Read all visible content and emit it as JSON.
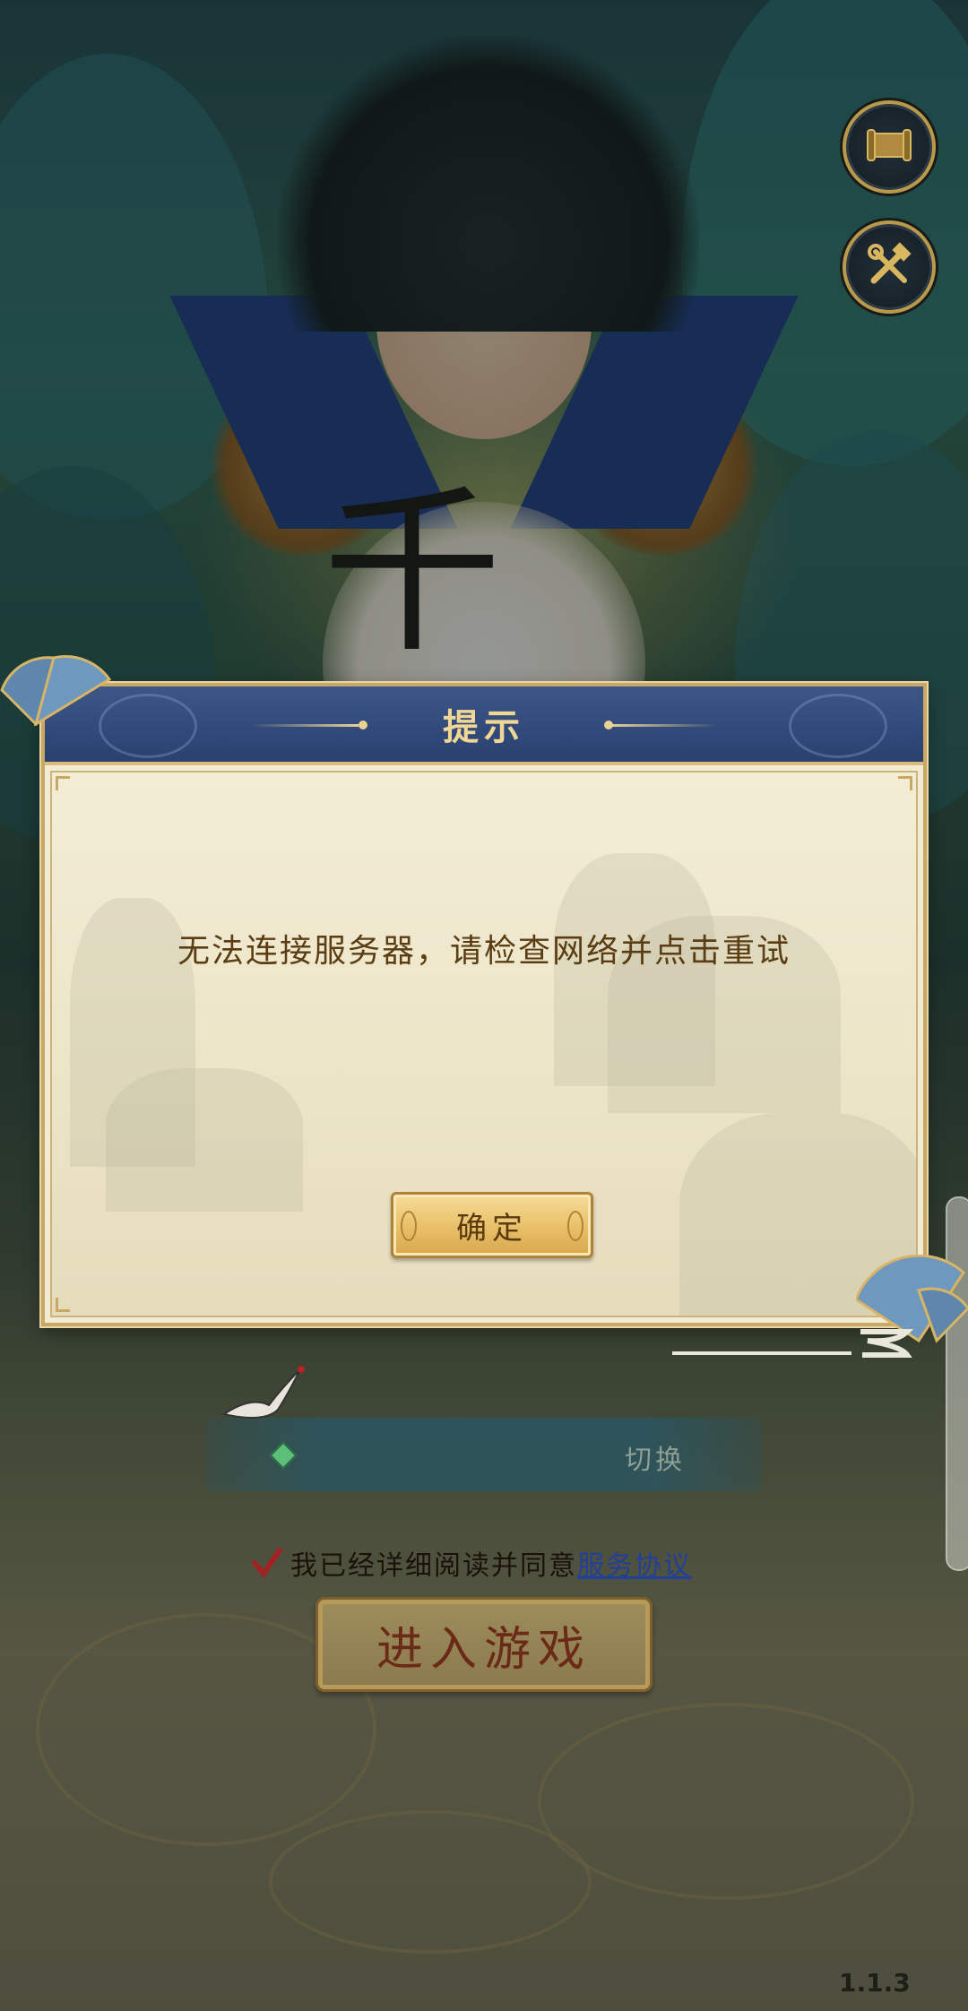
{
  "dialog": {
    "title": "提示",
    "message": "无法连接服务器，请检查网络并点击重试",
    "ok_label": "确定"
  },
  "server": {
    "switch_label": "切换"
  },
  "agreement": {
    "text": "我已经详细阅读并同意",
    "link": "服务协议",
    "checked": true
  },
  "enter_label": "进入游戏",
  "background_glyph": "千",
  "version": "1.1.3",
  "icons": {
    "top_button_1": "scroll-icon",
    "top_button_2": "tools-icon"
  },
  "colors": {
    "dialog_header": "#2a4170",
    "gold": "#e8bf68",
    "message_text": "#5a3d12",
    "link": "#223f9a"
  }
}
